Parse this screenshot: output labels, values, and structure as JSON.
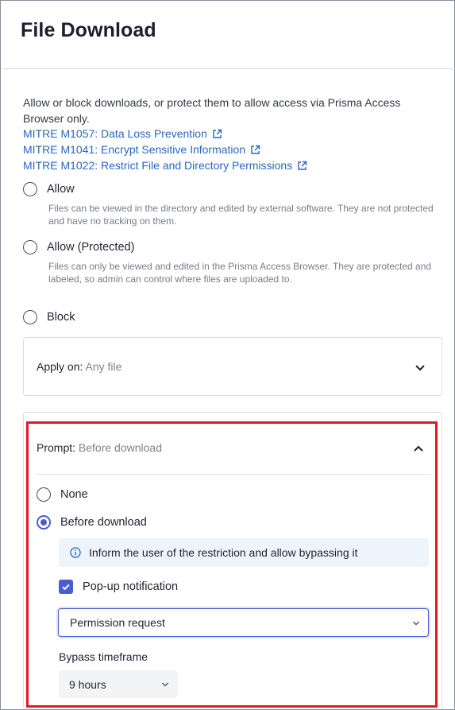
{
  "header": {
    "title": "File Download"
  },
  "description": "Allow or block downloads, or protect them to allow access via Prisma Access Browser only.",
  "links": [
    {
      "label": "MITRE M1057: Data Loss Prevention",
      "icon": "external-link-icon"
    },
    {
      "label": "MITRE M1041: Encrypt Sensitive Information",
      "icon": "external-link-icon"
    },
    {
      "label": "MITRE M1022: Restrict File and Directory Permissions",
      "icon": "external-link-icon"
    }
  ],
  "options": [
    {
      "label": "Allow",
      "description": "Files can be viewed in the directory and edited by external software. They are not protected and have no tracking on them.",
      "selected": false
    },
    {
      "label": "Allow (Protected)",
      "description": "Files can only be viewed and edited in the Prisma Access Browser. They are protected and labeled, so admin can control where files are uploaded to.",
      "selected": false
    },
    {
      "label": "Block",
      "selected": false
    }
  ],
  "apply_on": {
    "label": "Apply on:",
    "value": "Any file",
    "expanded": false,
    "icon": "chevron-down-icon"
  },
  "prompt": {
    "label": "Prompt:",
    "value": "Before download",
    "expanded": true,
    "icon": "chevron-up-icon",
    "options": [
      {
        "label": "None",
        "selected": false
      },
      {
        "label": "Before download",
        "selected": true
      }
    ],
    "info": {
      "text": "Inform the user of the restriction and allow bypassing it",
      "icon": "info-icon"
    },
    "popup": {
      "label": "Pop-up notification",
      "checked": true
    },
    "notification_type": {
      "value": "Permission request"
    },
    "bypass": {
      "label": "Bypass timeframe",
      "value": "9 hours"
    }
  },
  "colors": {
    "accent": "#4a5bd4",
    "link": "#2a66c2",
    "highlight": "#e01b24",
    "info_bg": "#eef4fc"
  }
}
